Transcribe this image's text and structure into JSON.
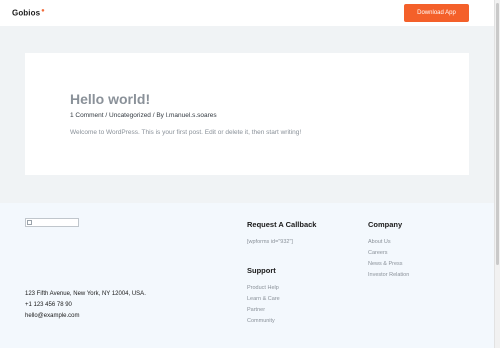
{
  "header": {
    "logo_text": "Gobios",
    "cta_label": "Download App"
  },
  "post": {
    "title": "Hello world!",
    "meta": "1 Comment / Uncategorized / By l.manuel.s.soares",
    "body": "Welcome to WordPress. This is your first post. Edit or delete it, then start writing!"
  },
  "footer": {
    "contact": {
      "address": "123 Fifth Avenue, New York, NY 12004, USA.",
      "phone": "+1 123 456 78 90",
      "email": "hello@example.com"
    },
    "callback": {
      "title": "Request A Callback",
      "shortcode": "[wpforms id=\"932\"]"
    },
    "support": {
      "title": "Support",
      "links": [
        "Product Help",
        "Learn & Care",
        "Partner",
        "Community"
      ]
    },
    "company": {
      "title": "Company",
      "links": [
        "About Us",
        "Careers",
        "News & Press",
        "Investor Relation"
      ]
    }
  },
  "colors": {
    "accent": "#f4602a",
    "footer_bg": "#f3f8fd",
    "page_bg": "#f0f3f5"
  }
}
